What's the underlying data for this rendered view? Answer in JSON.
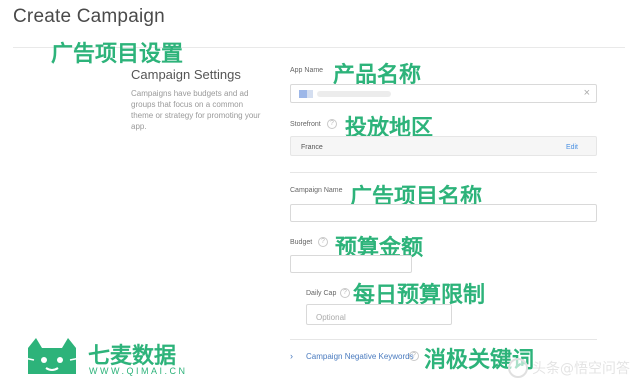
{
  "page": {
    "title": "Create Campaign"
  },
  "section": {
    "title": "Campaign Settings",
    "description": "Campaigns have budgets and ad groups that focus on a common theme or strategy for promoting your app."
  },
  "fields": {
    "app_name": {
      "label": "App Name",
      "clear": "×"
    },
    "storefront": {
      "label": "Storefront",
      "value": "France",
      "edit": "Edit"
    },
    "campaign_name": {
      "label": "Campaign Name",
      "value": ""
    },
    "budget": {
      "label": "Budget",
      "value": ""
    },
    "daily_cap": {
      "label": "Daily Cap",
      "placeholder": "Optional"
    },
    "negative_keywords": {
      "label": "Campaign Negative Keywords",
      "chevron": "›"
    }
  },
  "annotations": {
    "ad_settings": "广告项目设置",
    "product_name": "产品名称",
    "region": "投放地区",
    "campaign_name": "广告项目名称",
    "budget": "预算金额",
    "daily_budget": "每日预算限制",
    "negative_keywords": "消极关键词"
  },
  "branding": {
    "logo_cn": "七麦数据",
    "logo_url": "WWW.QIMAI.CN",
    "watermark": "头条@悟空问答",
    "brand_color": "#2db37a"
  },
  "icons": {
    "help": "?"
  }
}
